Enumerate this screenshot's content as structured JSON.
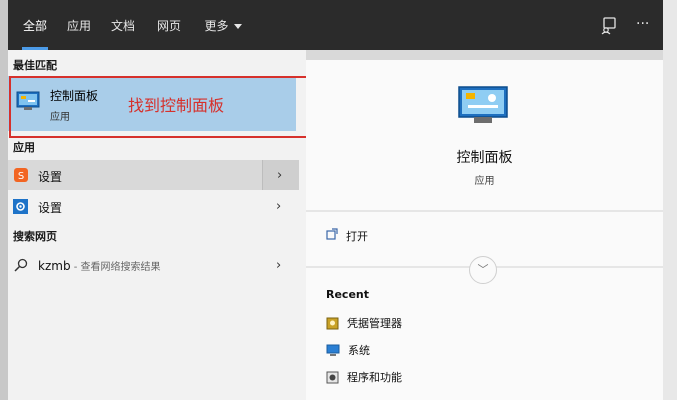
{
  "tabs": [
    {
      "label": "全部",
      "active": true
    },
    {
      "label": "应用",
      "active": false
    },
    {
      "label": "文档",
      "active": false
    },
    {
      "label": "网页",
      "active": false
    },
    {
      "label": "更多",
      "active": false,
      "dropdown": true
    }
  ],
  "top_icons": [
    "feedback-icon",
    "more-options-icon"
  ],
  "more_glyph": "···",
  "best_match": {
    "section": "最佳匹配",
    "title": "控制面板",
    "subtitle": "应用",
    "icon": "control-panel-icon"
  },
  "annotation": {
    "text": "找到控制面板",
    "color": "#d6312c"
  },
  "apps": {
    "section": "应用",
    "items": [
      {
        "label": "设置",
        "icon": "sogou-settings-icon"
      },
      {
        "label": "设置",
        "icon": "gear-settings-icon"
      }
    ]
  },
  "web": {
    "section": "搜索网页",
    "item": {
      "label": "kzmb",
      "suffix": " - 查看网络搜索结果",
      "icon": "search-icon"
    }
  },
  "detail": {
    "title": "控制面板",
    "subtitle": "应用",
    "open_label": "打开",
    "recent_heading": "Recent",
    "recent": [
      {
        "label": "凭据管理器",
        "icon": "credential-manager-icon"
      },
      {
        "label": "系统",
        "icon": "system-icon"
      },
      {
        "label": "程序和功能",
        "icon": "programs-features-icon"
      }
    ]
  },
  "colors": {
    "accent": "#4c9be8",
    "selection": "#a9cde9",
    "topbar": "#2b2b2b"
  }
}
